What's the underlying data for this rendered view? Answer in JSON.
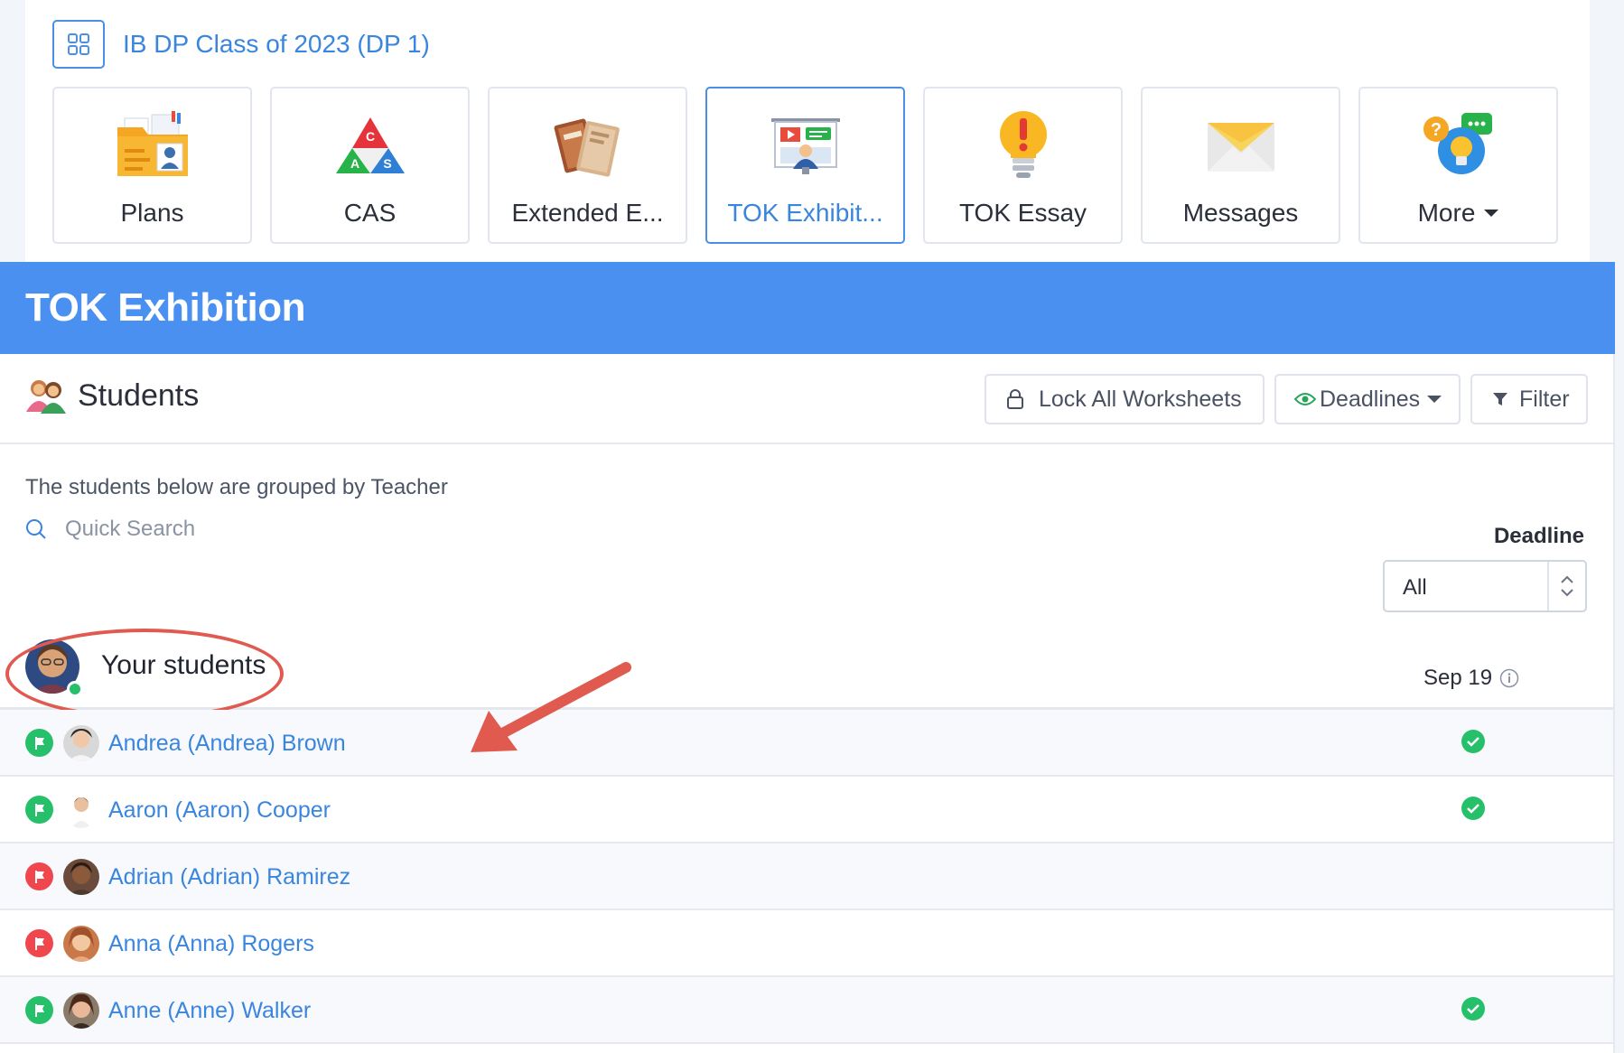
{
  "class_bar": {
    "title": "IB DP Class of 2023 (DP 1)"
  },
  "tiles": [
    {
      "label": "Plans",
      "icon": "plans-folder-icon"
    },
    {
      "label": "CAS",
      "icon": "cas-triangle-icon"
    },
    {
      "label": "Extended E...",
      "icon": "extended-essay-books-icon"
    },
    {
      "label": "TOK Exhibit...",
      "icon": "tok-exhibition-presentation-icon",
      "active": true
    },
    {
      "label": "TOK Essay",
      "icon": "lightbulb-exclamation-icon"
    },
    {
      "label": "Messages",
      "icon": "envelope-icon"
    },
    {
      "label": "More",
      "icon": "question-lightbulb-chat-icon"
    }
  ],
  "banner": {
    "title": "TOK Exhibition"
  },
  "students_section": {
    "heading": "Students",
    "lock_label": "Lock All Worksheets",
    "deadlines_label": "Deadlines",
    "filter_label": "Filter",
    "grouped_note": "The students below are grouped by Teacher",
    "search_placeholder": "Quick Search",
    "deadline_label": "Deadline",
    "deadline_value": "All"
  },
  "group": {
    "title": "Your students",
    "column_header": "Sep 19"
  },
  "students": [
    {
      "name": "Andrea (Andrea) Brown",
      "flag": "green",
      "completed": true
    },
    {
      "name": "Aaron (Aaron) Cooper",
      "flag": "green",
      "completed": true
    },
    {
      "name": "Adrian (Adrian) Ramirez",
      "flag": "red",
      "completed": false
    },
    {
      "name": "Anna (Anna) Rogers",
      "flag": "red",
      "completed": false
    },
    {
      "name": "Anne (Anne) Walker",
      "flag": "green",
      "completed": true
    }
  ],
  "colors": {
    "accent": "#4a90f0",
    "link": "#3a85de",
    "flag_green": "#27c06a",
    "flag_red": "#f0474f",
    "annotation": "#e05a4f"
  }
}
